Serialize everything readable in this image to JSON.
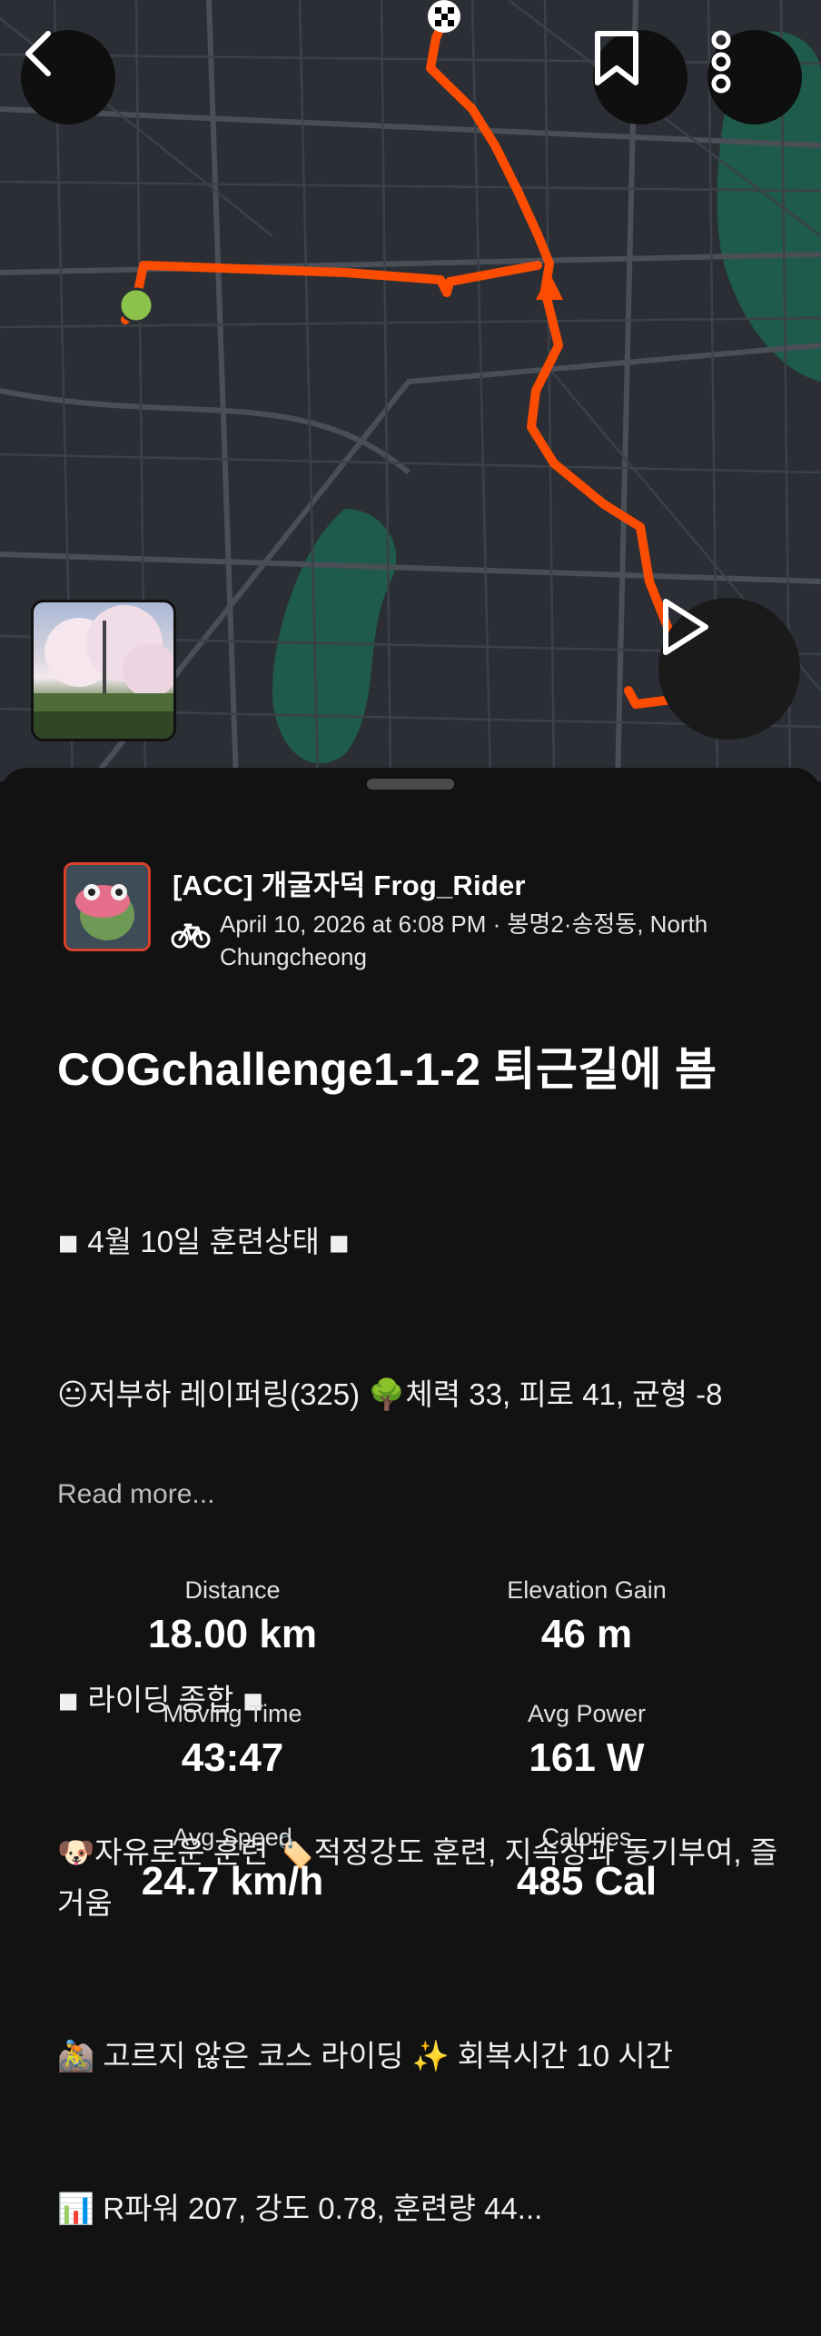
{
  "map": {
    "start_marker_color": "#8bc34a",
    "route_color": "#fc4c02",
    "park_color": "#1f5b4a"
  },
  "header": {
    "back_icon": "chevron-left-icon",
    "bookmark_icon": "bookmark-icon",
    "more_icon": "more-vertical-icon",
    "play_icon": "play-icon"
  },
  "athlete": {
    "name": "[ACC] 개굴자덕 Frog_Rider",
    "activity_type_icon": "bike-icon",
    "meta": "April 10, 2026 at 6:08 PM · 봉명2·송정동, North Chungcheong"
  },
  "activity": {
    "title": "COGchallenge1-1-2 퇴근길에 봄",
    "description_lines": [
      "◾ 4월 10일 훈련상태 ◾",
      "😐저부하 레이퍼링(325) 🌳체력 33, 피로 41, 균형 -8",
      "",
      "◾ 라이딩 종합 ◾",
      "🐶자유로운 훈련 🏷️적정강도 훈련, 지속성과 동기부여, 즐거움",
      "🚵 고르지 않은 코스 라이딩 ✨ 회복시간 10 시간",
      "📊 R파워 207, 강도 0.78, 훈련량 44..."
    ],
    "read_more": "Read more..."
  },
  "stats": [
    {
      "label": "Distance",
      "value": "18.00 km"
    },
    {
      "label": "Elevation Gain",
      "value": "46 m"
    },
    {
      "label": "Moving Time",
      "value": "43:47"
    },
    {
      "label": "Avg Power",
      "value": "161 W"
    },
    {
      "label": "Avg Speed",
      "value": "24.7 km/h"
    },
    {
      "label": "Calories",
      "value": "485 Cal"
    }
  ]
}
